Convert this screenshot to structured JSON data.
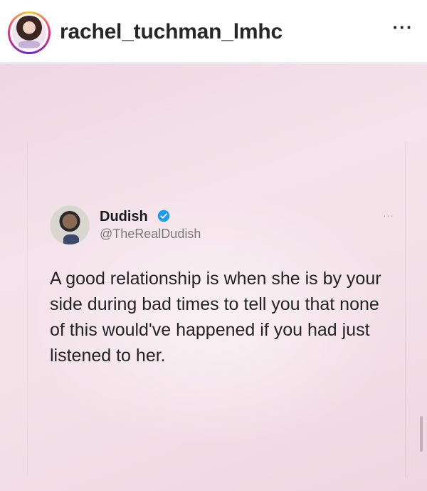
{
  "header": {
    "username": "rachel_tuchman_lmhc",
    "more_label": "···"
  },
  "tweet": {
    "display_name": "Dudish",
    "handle": "@TheRealDudish",
    "more_label": "···",
    "text": "A good relationship is when she is by your side during bad times to tell you that none of this would've happened if you had just listened to her."
  },
  "colors": {
    "background": "#f3e1e8",
    "verified": "#1d9bf0",
    "text": "#242424"
  },
  "icons": {
    "avatar": "profile-avatar-icon",
    "verified": "verified-badge-icon"
  }
}
